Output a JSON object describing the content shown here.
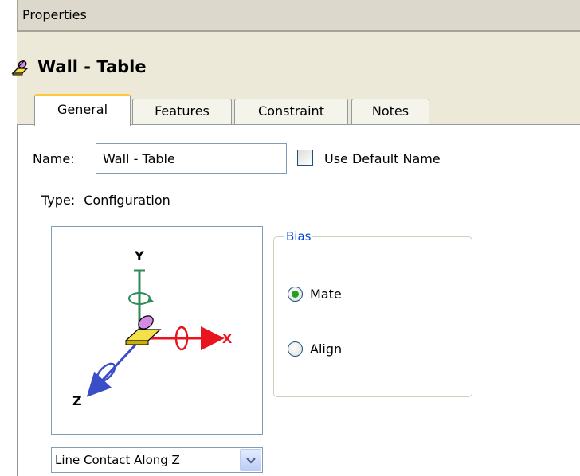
{
  "panel": {
    "header_title": "Properties"
  },
  "object": {
    "title": "Wall - Table",
    "icon": "line-contact-constraint-icon"
  },
  "tabs": [
    {
      "label": "General",
      "active": true
    },
    {
      "label": "Features",
      "active": false
    },
    {
      "label": "Constraint",
      "active": false
    },
    {
      "label": "Notes",
      "active": false
    }
  ],
  "general": {
    "name_label": "Name:",
    "name_value": "Wall - Table",
    "use_default_name_label": "Use Default Name",
    "use_default_name_checked": false,
    "type_label": "Type:",
    "type_value": "Configuration"
  },
  "diagram": {
    "axis_y": "Y",
    "axis_x": "X",
    "axis_z": "Z"
  },
  "bias": {
    "legend": "Bias",
    "options": [
      {
        "label": "Mate",
        "selected": true
      },
      {
        "label": "Align",
        "selected": false
      }
    ]
  },
  "contact_select": {
    "value": "Line Contact Along Z"
  },
  "colors": {
    "tab_highlight": "#ffc83c",
    "legend_blue": "#0046d5",
    "radio_green": "#21a121",
    "axis_red": "#e8141e",
    "axis_green": "#2e8b57",
    "axis_blue": "#3a4ec8"
  }
}
